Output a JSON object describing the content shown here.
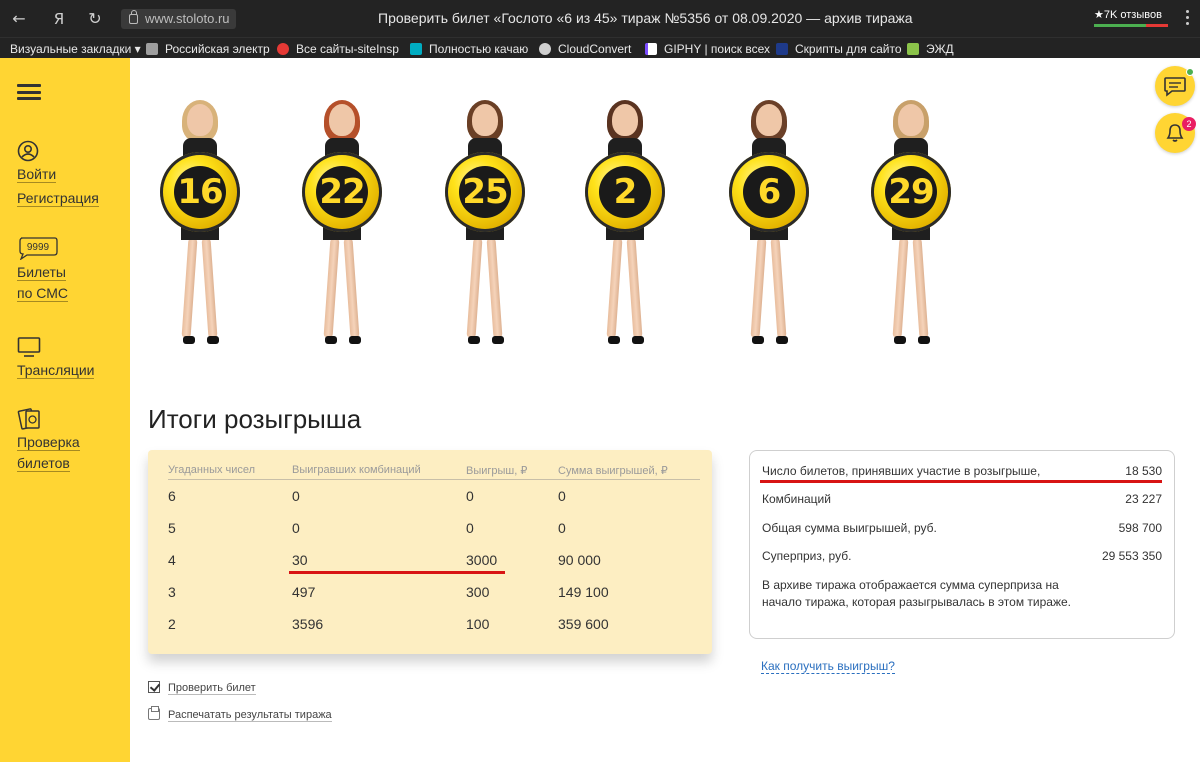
{
  "browser": {
    "url": "www.stoloto.ru",
    "title": "Проверить билет «Гослото «6 из 45» тираж №5356 от 08.09.2020 — архив тиража",
    "reviews": "★7K отзывов",
    "bookmarks": [
      {
        "label": "Визуальные закладки ▾",
        "color": "#232323"
      },
      {
        "label": "Российская электр",
        "color": "#9e9e9e"
      },
      {
        "label": "Все сайты-siteInsp",
        "color": "#e53935"
      },
      {
        "label": "Полностью качаю",
        "color": "#00acc1"
      },
      {
        "label": "CloudConvert",
        "color": "#cfcfcf"
      },
      {
        "label": "GIPHY | поиск всех",
        "color": "#ffffff"
      },
      {
        "label": "Скрипты для сайто",
        "color": "#1e3a8a"
      },
      {
        "label": "ЭЖД",
        "color": "#8bc34a"
      }
    ]
  },
  "sidebar": {
    "login": "Войти",
    "register": "Регистрация",
    "sms_badge": "9999",
    "sms_line1": "Билеты",
    "sms_line2": "по СМС",
    "broadcasts": "Трансляции",
    "check_line1": "Проверка",
    "check_line2": "билетов"
  },
  "balls": [
    "16",
    "22",
    "25",
    "2",
    "6",
    "29"
  ],
  "heading": "Итоги розыгрыша",
  "results": {
    "headers": [
      "Угаданных чисел",
      "Выигравших комбинаций",
      "Выигрыш, ₽",
      "Сумма выигрышей, ₽"
    ],
    "rows": [
      [
        "6",
        "0",
        "0",
        "0"
      ],
      [
        "5",
        "0",
        "0",
        "0"
      ],
      [
        "4",
        "30",
        "3000",
        "90 000"
      ],
      [
        "3",
        "497",
        "300",
        "149 100"
      ],
      [
        "2",
        "3596",
        "100",
        "359 600"
      ]
    ]
  },
  "stats": {
    "items": [
      {
        "label": "Число билетов, принявших участие в розыгрыше,",
        "value": "18 530"
      },
      {
        "label": "Комбинаций",
        "value": "23 227"
      },
      {
        "label": "Общая сумма выигрышей, руб.",
        "value": "598 700"
      },
      {
        "label": "Суперприз, руб.",
        "value": "29 553 350"
      }
    ],
    "note": "В архиве тиража отображается сумма суперприза на начало тиража, которая разыгрывалась в этом тираже."
  },
  "links": {
    "how_to_get": "Как получить выигрыш?",
    "check_ticket": "Проверить билет",
    "print_results": "Распечатать результаты тиража"
  },
  "notifications": {
    "count": "2"
  },
  "colors": {
    "accent": "#ffd533",
    "results_bg": "#fdeec2",
    "highlight_red": "#d81414",
    "link": "#2a6fbf"
  }
}
